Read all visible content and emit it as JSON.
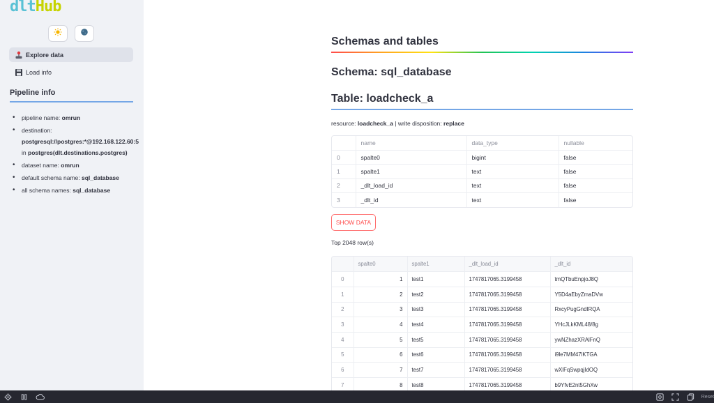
{
  "sidebar": {
    "logo_part1": "dlt",
    "logo_part2": "Hub",
    "theme_buttons": [
      {
        "icon": "sun-icon"
      },
      {
        "icon": "moon-icon"
      }
    ],
    "nav": [
      {
        "label": "Explore data",
        "icon": "joystick-icon",
        "active": true
      },
      {
        "label": "Load info",
        "icon": "floppy-disk-icon",
        "active": false
      }
    ],
    "pipeline_info_heading": "Pipeline info",
    "info": {
      "pipeline_name_label": "pipeline name:",
      "pipeline_name": "omrun",
      "destination_label": "destination:",
      "destination_url": "postgresql://postgres:*@192.168.122.60:5",
      "destination_in": "in",
      "destination_impl": "postgres(dlt.destinations.postgres)",
      "dataset_name_label": "dataset name:",
      "dataset_name": "omrun",
      "default_schema_label": "default schema name:",
      "default_schema": "sql_database",
      "all_schemas_label": "all schema names:",
      "all_schemas": "sql_database"
    }
  },
  "main": {
    "title": "Schemas and tables",
    "schema_heading": "Schema: sql_database",
    "table_heading": "Table: loadcheck_a",
    "resource_label": "resource:",
    "resource": "loadcheck_a",
    "separator": "|",
    "write_disposition_label": "write disposition:",
    "write_disposition": "replace",
    "schema_table": {
      "columns": [
        "name",
        "data_type",
        "nullable"
      ],
      "rows": [
        {
          "idx": "0",
          "name": "spalte0",
          "data_type": "bigint",
          "nullable": "false"
        },
        {
          "idx": "1",
          "name": "spalte1",
          "data_type": "text",
          "nullable": "false"
        },
        {
          "idx": "2",
          "name": "_dlt_load_id",
          "data_type": "text",
          "nullable": "false"
        },
        {
          "idx": "3",
          "name": "_dlt_id",
          "data_type": "text",
          "nullable": "false"
        }
      ]
    },
    "show_data_label": "SHOW DATA",
    "top_rows_label": "Top 2048 row(s)",
    "data_table": {
      "columns": [
        "spalte0",
        "spalte1",
        "_dlt_load_id",
        "_dlt_id"
      ],
      "rows": [
        {
          "idx": "0",
          "spalte0": "1",
          "spalte1": "test1",
          "load_id": "1747817065.3199458",
          "dlt_id": "tmQTbuEnpjoJ8Q"
        },
        {
          "idx": "1",
          "spalte0": "2",
          "spalte1": "test2",
          "load_id": "1747817065.3199458",
          "dlt_id": "Y5D4aEbyZmaDVw"
        },
        {
          "idx": "2",
          "spalte0": "3",
          "spalte1": "test3",
          "load_id": "1747817065.3199458",
          "dlt_id": "RxcyPugGndIRQA"
        },
        {
          "idx": "3",
          "spalte0": "4",
          "spalte1": "test4",
          "load_id": "1747817065.3199458",
          "dlt_id": "YHcJLkKML48/8g"
        },
        {
          "idx": "4",
          "spalte0": "5",
          "spalte1": "test5",
          "load_id": "1747817065.3199458",
          "dlt_id": "ywNZhazXRAlFnQ"
        },
        {
          "idx": "5",
          "spalte0": "6",
          "spalte1": "test6",
          "load_id": "1747817065.3199458",
          "dlt_id": "i9le7MM47lKTGA"
        },
        {
          "idx": "6",
          "spalte0": "7",
          "spalte1": "test7",
          "load_id": "1747817065.3199458",
          "dlt_id": "wXlFqSwpqjIdOQ"
        },
        {
          "idx": "7",
          "spalte0": "8",
          "spalte1": "test8",
          "load_id": "1747817065.3199458",
          "dlt_id": "b9YfvE2nt5GhXw"
        }
      ]
    }
  },
  "bottombar": {
    "right_text": "Reset"
  },
  "colors": {
    "sidebar_bg": "#f0f2f6",
    "accent_red": "#ff4b4b",
    "rule_blue": "#74a6e6",
    "text": "#31333f",
    "bottombar_bg": "#262730"
  }
}
